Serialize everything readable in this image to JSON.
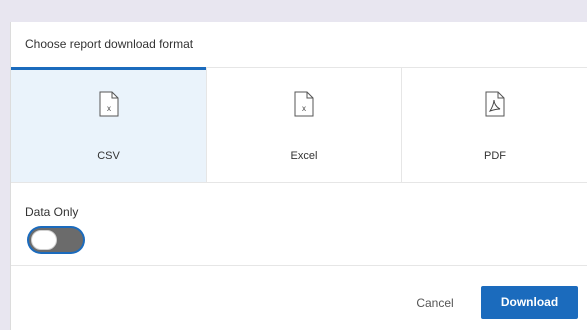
{
  "dialog": {
    "title": "Choose report download format",
    "formats": [
      {
        "label": "CSV",
        "icon": "csv-file-icon",
        "selected": true
      },
      {
        "label": "Excel",
        "icon": "excel-file-icon",
        "selected": false
      },
      {
        "label": "PDF",
        "icon": "pdf-file-icon",
        "selected": false
      }
    ],
    "data_only": {
      "label": "Data Only",
      "enabled": false
    },
    "actions": {
      "cancel_label": "Cancel",
      "download_label": "Download"
    }
  },
  "colors": {
    "accent": "#1b6bbd",
    "selected_bg": "#eaf3fb",
    "backdrop": "#e8e6f0",
    "toggle_off": "#6b6b6b"
  }
}
